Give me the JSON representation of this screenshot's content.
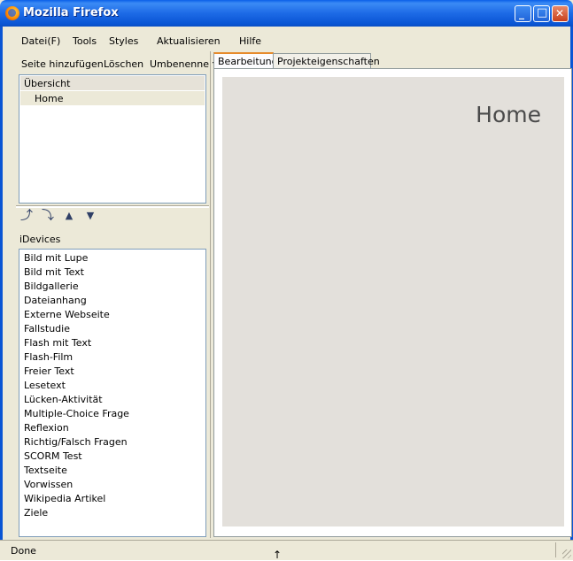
{
  "window": {
    "title": "Mozilla Firefox",
    "minimize_glyph": "_",
    "maximize_glyph": "□",
    "close_glyph": "✕"
  },
  "menu": [
    "Datei(F)",
    "Tools",
    "Styles",
    "Aktualisieren",
    "Hilfe"
  ],
  "outline_toolbar": {
    "add_page": "Seite hinzufügen",
    "delete": "Löschen",
    "rename": "Umbenennen"
  },
  "outline": {
    "header": "Übersicht",
    "items": [
      "Home"
    ]
  },
  "outline_arrows": {
    "promote": "⤴",
    "demote": "⤵",
    "up": "▲",
    "down": "▼"
  },
  "idevices": {
    "label": "iDevices",
    "items": [
      "Bild mit Lupe",
      "Bild mit Text",
      "Bildgallerie",
      "Dateianhang",
      "Externe Webseite",
      "Fallstudie",
      "Flash mit Text",
      "Flash-Film",
      "Freier Text",
      "Lesetext",
      "Lücken-Aktivität",
      "Multiple-Choice Frage",
      "Reflexion",
      "Richtig/Falsch Fragen",
      "SCORM Test",
      "Textseite",
      "Vorwissen",
      "Wikipedia Artikel",
      "Ziele"
    ]
  },
  "tabs": [
    "Bearbeitung",
    "Projekteigenschaften"
  ],
  "page": {
    "title": "Home"
  },
  "status": {
    "text": "Done"
  }
}
